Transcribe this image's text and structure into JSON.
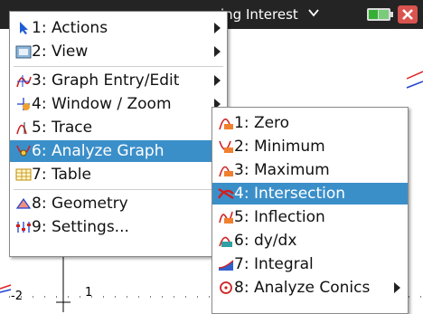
{
  "titlebar": {
    "title": "ing Interest"
  },
  "graph": {
    "tick_label_neg2": "-2",
    "tick_label_1": "1"
  },
  "menu_main": {
    "items": [
      {
        "key": "actions",
        "label": "1: Actions",
        "icon": "arrow-pointer-icon",
        "submenu": true
      },
      {
        "key": "view",
        "label": "2: View",
        "icon": "view-icon",
        "submenu": true
      },
      {
        "key": "graph-entry",
        "label": "3: Graph Entry/Edit",
        "icon": "graph-entry-icon",
        "submenu": true
      },
      {
        "key": "window-zoom",
        "label": "4: Window / Zoom",
        "icon": "window-zoom-icon",
        "submenu": true
      },
      {
        "key": "trace",
        "label": "5: Trace",
        "icon": "trace-icon",
        "submenu": true
      },
      {
        "key": "analyze-graph",
        "label": "6: Analyze Graph",
        "icon": "analyze-graph-icon",
        "submenu": true,
        "selected": true
      },
      {
        "key": "table",
        "label": "7: Table",
        "icon": "table-icon",
        "submenu": true
      },
      {
        "key": "geometry",
        "label": "8: Geometry",
        "icon": "geometry-icon",
        "submenu": true
      },
      {
        "key": "settings",
        "label": "9: Settings...",
        "icon": "settings-icon",
        "submenu": false
      }
    ]
  },
  "menu_analyze": {
    "items": [
      {
        "key": "zero",
        "label": "1: Zero",
        "icon": "zero-icon"
      },
      {
        "key": "minimum",
        "label": "2: Minimum",
        "icon": "minimum-icon"
      },
      {
        "key": "maximum",
        "label": "3: Maximum",
        "icon": "maximum-icon"
      },
      {
        "key": "intersection",
        "label": "4: Intersection",
        "icon": "intersection-icon",
        "selected": true
      },
      {
        "key": "inflection",
        "label": "5: Inflection",
        "icon": "inflection-icon"
      },
      {
        "key": "dydx",
        "label": "6: dy/dx",
        "icon": "dydx-icon"
      },
      {
        "key": "integral",
        "label": "7: Integral",
        "icon": "integral-icon"
      },
      {
        "key": "analyze-conics",
        "label": "8: Analyze Conics",
        "icon": "conics-icon",
        "submenu": true
      }
    ]
  },
  "colors": {
    "selection": "#3b8fc9",
    "titlebar": "#242424",
    "curve_red": "#e02020",
    "curve_blue": "#2040d0"
  }
}
